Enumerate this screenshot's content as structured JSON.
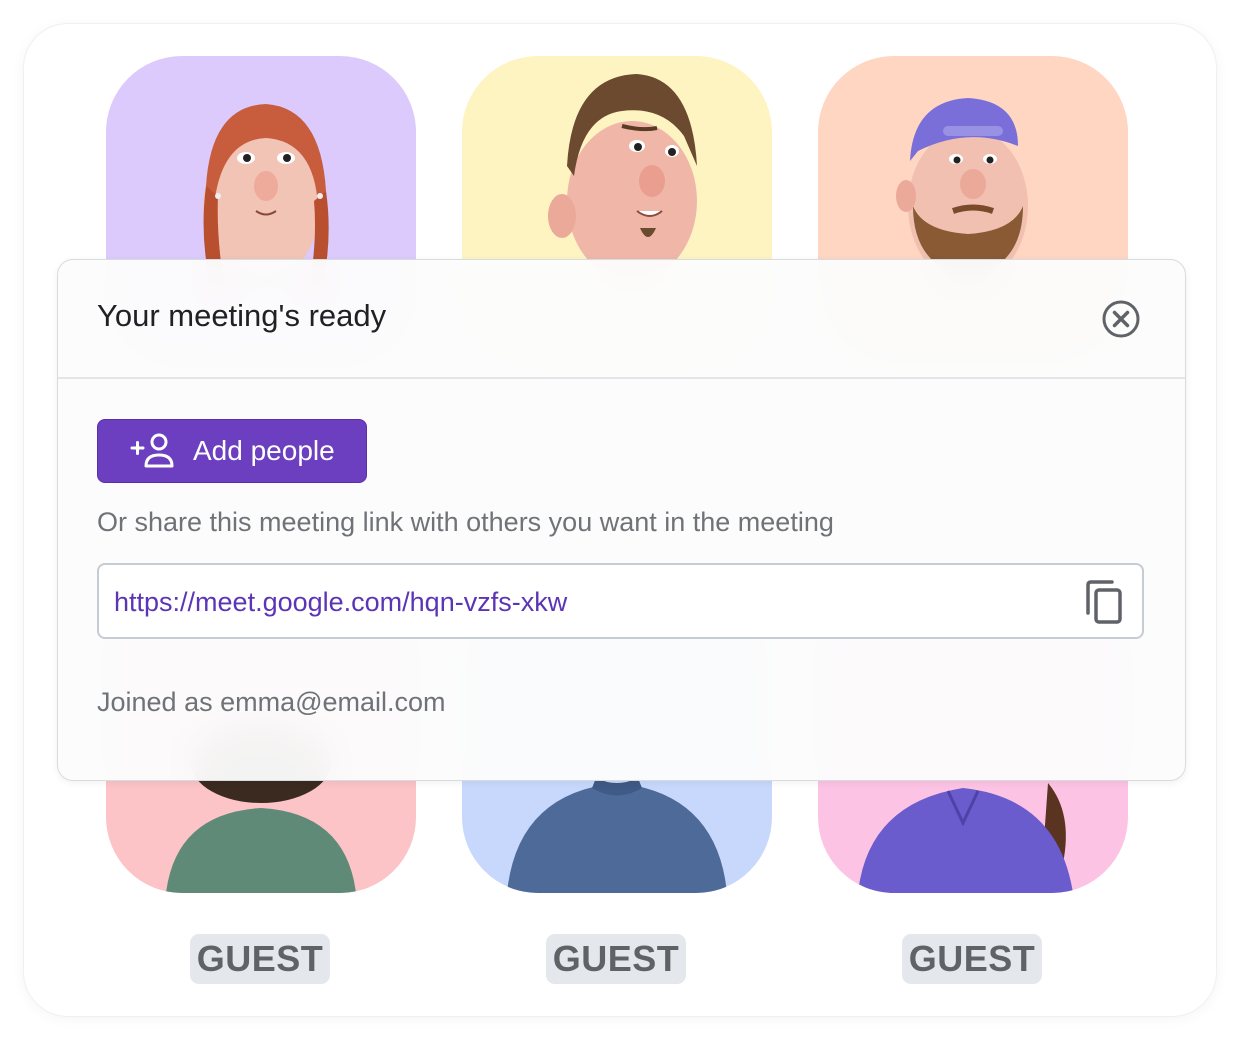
{
  "dialog": {
    "title": "Your meeting's ready",
    "close_icon": "close-circle-icon",
    "add_button_label": "Add people",
    "add_icon": "add-person-icon",
    "share_text": "Or share this meeting link with others you want in the meeting",
    "link": "https://meet.google.com/hqn-vzfs-xkw",
    "copy_icon": "copy-icon",
    "joined_text": "Joined as emma@email.com"
  },
  "participants": [
    {
      "badge": "",
      "bg": "#dccafc"
    },
    {
      "badge": "",
      "bg": "#fdf4c2"
    },
    {
      "badge": "",
      "bg": "#fed6c2"
    },
    {
      "badge": "GUEST",
      "bg": "#fcc4c6"
    },
    {
      "badge": "GUEST",
      "bg": "#c7d8fc"
    },
    {
      "badge": "GUEST",
      "bg": "#fdc3e4"
    }
  ],
  "colors": {
    "accent": "#6b3fc0",
    "link": "#5b35b6",
    "muted_text": "#6f7378",
    "badge_bg": "#e4e7eb"
  }
}
